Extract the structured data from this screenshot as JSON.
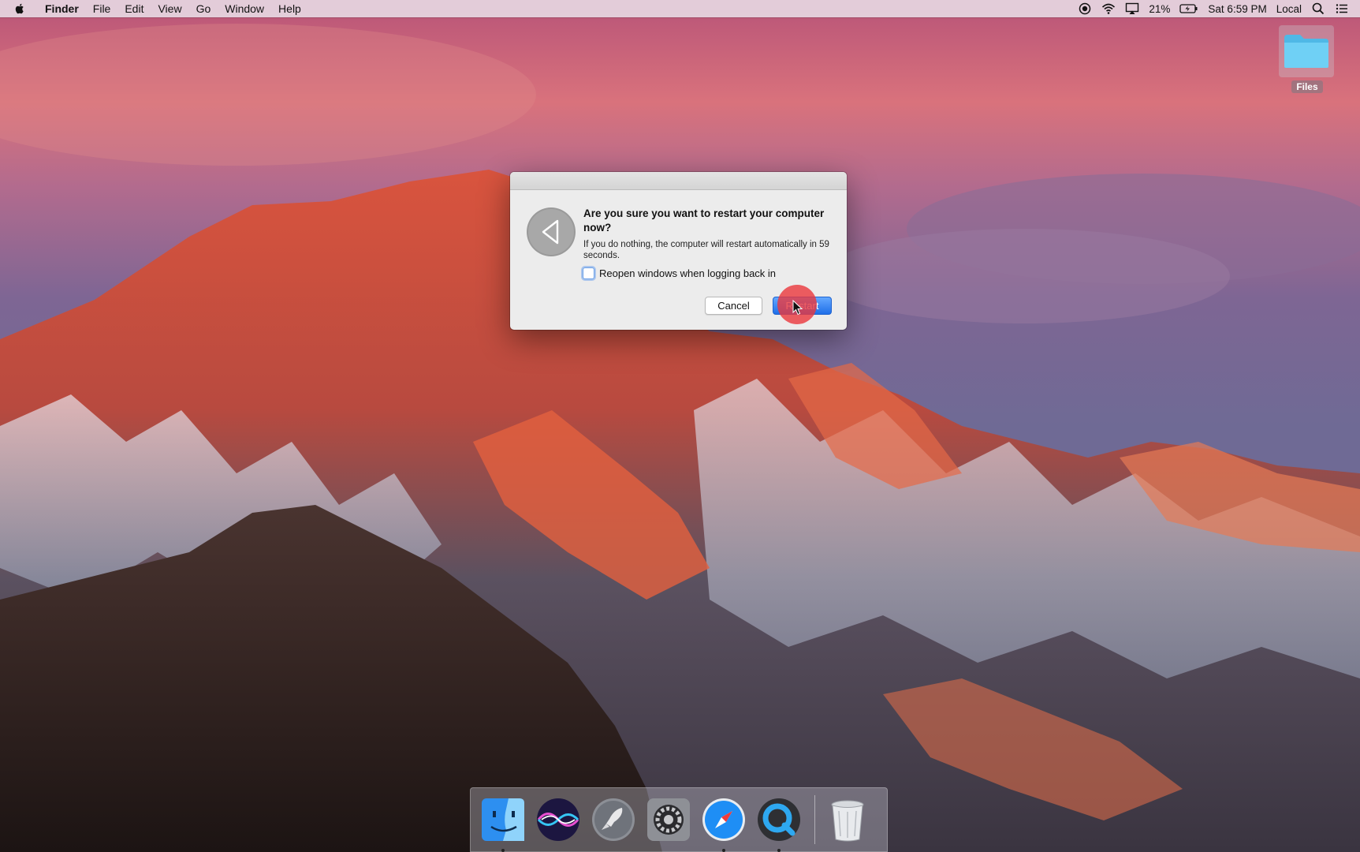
{
  "menubar": {
    "app_name": "Finder",
    "menus": [
      "File",
      "Edit",
      "View",
      "Go",
      "Window",
      "Help"
    ],
    "battery_text": "21%",
    "clock": "Sat 6:59 PM",
    "user": "Local"
  },
  "desktop": {
    "icons": [
      {
        "label": "Files"
      }
    ]
  },
  "dialog": {
    "title": "Are you sure you want to restart your computer now?",
    "body": "If you do nothing, the computer will restart automatically in 59 seconds.",
    "checkbox_label": "Reopen windows when logging back in",
    "checkbox_checked": false,
    "cancel_label": "Cancel",
    "confirm_label": "Restart"
  },
  "dock": {
    "apps": [
      "finder-icon",
      "siri-icon",
      "launchpad-icon",
      "system-preferences-icon",
      "safari-icon",
      "quicktime-icon",
      "trash-icon"
    ]
  },
  "colors": {
    "accent_blue": "#1f6fe8",
    "click_marker": "#eb373c",
    "folder_blue": "#5bc6f0"
  }
}
